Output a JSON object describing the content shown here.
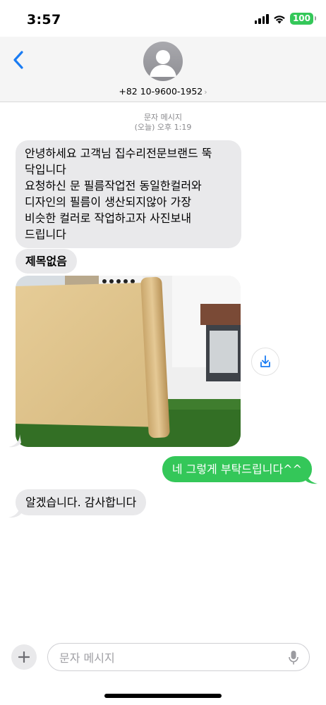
{
  "status": {
    "time": "3:57",
    "battery": "100"
  },
  "header": {
    "contact": "+82 10-9600-1952",
    "chevron": "›"
  },
  "thread": {
    "type_label": "문자 메시지",
    "timestamp": "(오늘) 오후 1:19"
  },
  "messages": [
    {
      "from": "them",
      "lines": [
        "안녕하세요 고객님 집수리전문브랜드 뚝",
        "닥입니다",
        "요청하신 문 필름작업전 동일한컬러와",
        "디자인의 필름이 생산되지않아 가장",
        "비슷한 컬러로 작업하고자 사진보내",
        "드립니다"
      ]
    },
    {
      "from": "them",
      "subject": "제목없음"
    },
    {
      "from": "me",
      "text": "네 그렇게 부탁드립니다^^"
    },
    {
      "from": "them",
      "text": "알겠습니다. 감사합니다"
    }
  ],
  "input": {
    "placeholder": "문자 메시지"
  },
  "colors": {
    "outgoing": "#34c759",
    "incoming": "#e9e9eb",
    "accent": "#1a7cf3"
  }
}
